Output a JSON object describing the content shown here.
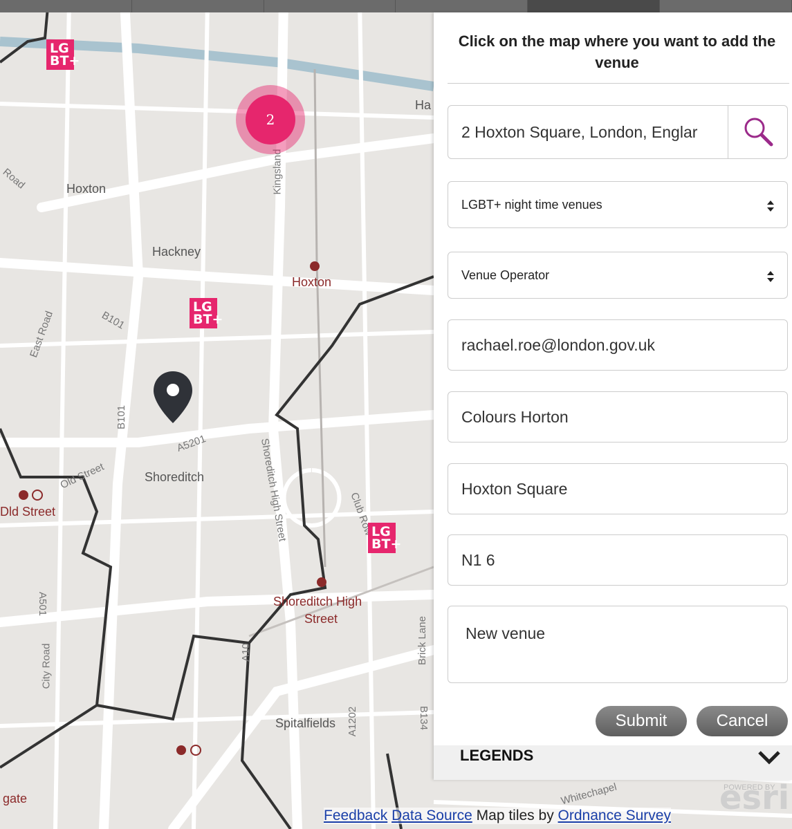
{
  "map": {
    "place_labels": [
      "Hoxton",
      "Hackney",
      "Shoreditch",
      "Spitalfields"
    ],
    "station_labels": [
      "Hoxton",
      "Old Street",
      "Shoreditch High Street"
    ],
    "station_label_partial": [
      "Hoxton",
      "Dld Street",
      "Shoreditch High",
      "Street"
    ],
    "road_labels": [
      "Kingsland",
      "B101",
      "B101",
      "A5201",
      "Old Street",
      "Shoreditch High Street",
      "Club Row",
      "A501",
      "City Road",
      "A10",
      "A1202",
      "B134",
      "Brick Lane",
      "East Road",
      "Whitechapel",
      "Ha",
      "gate",
      "Road"
    ],
    "cluster_count": "2",
    "lgbt_badge": "LG BT+",
    "colors": {
      "accent": "#e6266d",
      "boundary": "#333333"
    }
  },
  "panel": {
    "title": "Click on the map where you want to add the venue",
    "address_value": "2 Hoxton Square, London, Englar",
    "category_value": "LGBT+ night time venues",
    "role_value": "Venue Operator",
    "email_value": "rachael.roe@london.gov.uk",
    "venue_name_value": "Colours Horton",
    "street_value": "Hoxton Square",
    "postcode_value": "N1 6",
    "notes_value": "New venue",
    "submit_label": "Submit",
    "cancel_label": "Cancel",
    "legends_label": "LEGENDS",
    "search_icon": "search-icon"
  },
  "footer": {
    "feedback": "Feedback",
    "data_source": "Data Source",
    "tiles_text": "Map tiles by",
    "ordnance": "Ordnance Survey",
    "powered": "POWERED BY",
    "esri": "esri"
  }
}
